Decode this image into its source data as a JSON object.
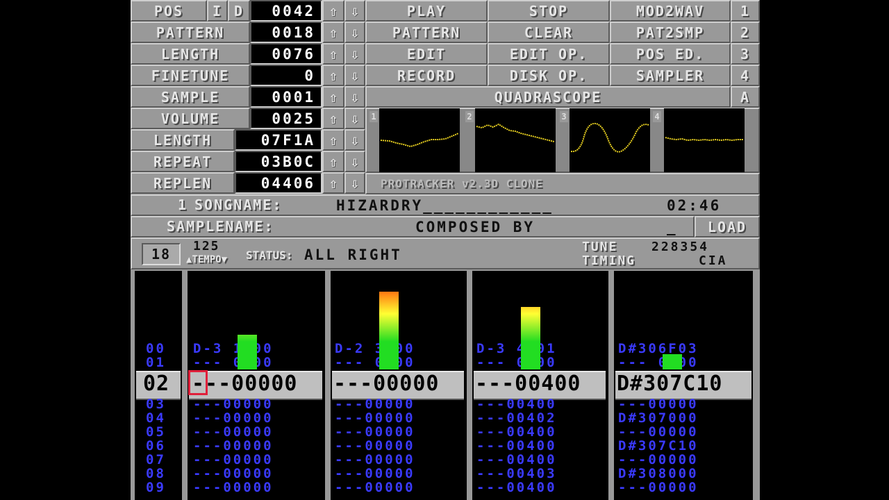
{
  "top_panel": {
    "pos_label": "POS",
    "i_label": "I",
    "d_label": "D",
    "pos_value": "0042",
    "pattern_label": "PATTERN",
    "pattern_value": "0018",
    "length_label": "LENGTH",
    "length_value": "0076",
    "finetune_label": "FINETUNE",
    "finetune_value": "0",
    "sample_label": "SAMPLE",
    "sample_value": "0001",
    "volume_label": "VOLUME",
    "volume_value": "0025",
    "slength_label": "LENGTH",
    "slength_value": "07F1A",
    "repeat_label": "REPEAT",
    "repeat_value": "03B0C",
    "replen_label": "REPLEN",
    "replen_value": "04406",
    "up_arrow": "⇧",
    "down_arrow": "⇩"
  },
  "menu": {
    "play": "PLAY",
    "stop": "STOP",
    "mod2wav": "MOD2WAV",
    "pattern": "PATTERN",
    "clear": "CLEAR",
    "pat2smp": "PAT2SMP",
    "edit": "EDIT",
    "edit_op": "EDIT OP.",
    "pos_ed": "POS ED.",
    "record": "RECORD",
    "disk_op": "DISK OP.",
    "sampler": "SAMPLER",
    "num1": "1",
    "num2": "2",
    "num3": "3",
    "num4": "4",
    "quadrascope": "QUADRASCOPE",
    "quadrascope_key": "A"
  },
  "scopes": {
    "labels": [
      "1",
      "2",
      "3",
      "4"
    ],
    "caption": "PROTRACKER v2.3D CLONE",
    "color": "#e8d020"
  },
  "song": {
    "index": "1",
    "label": "SONGNAME:",
    "name": "HIZARDRY____________",
    "time": "02:46"
  },
  "sample_row": {
    "label": "SAMPLENAME:",
    "name": "COMPOSED BY",
    "underscore": "_",
    "load": "LOAD"
  },
  "status": {
    "pattern_box": "18",
    "tempo_value": "125",
    "tempo_label": "▲TEMPO▼",
    "status_label": "STATUS:",
    "status_text": "ALL RIGHT",
    "tune_label": "TUNE",
    "tune_value": "228354",
    "timing_label": "TIMING",
    "timing_value": "CIA"
  },
  "tracker": {
    "row_numbers_above": [
      "00",
      "01"
    ],
    "current_row": "02",
    "row_numbers_below": [
      "03",
      "04",
      "05",
      "06",
      "07",
      "08",
      "09"
    ],
    "channels": [
      {
        "above": [
          "D-3 1000",
          "--- 0000"
        ],
        "current": "---00000",
        "below": [
          "---00000",
          "---00000",
          "---00000",
          "---00000",
          "---00000",
          "---00000",
          "---00000"
        ]
      },
      {
        "above": [
          "D-2 3000",
          "--- 0000"
        ],
        "current": "---00000",
        "below": [
          "---00000",
          "---00000",
          "---00000",
          "---00000",
          "---00000",
          "---00000",
          "---00000"
        ]
      },
      {
        "above": [
          "D-3 4401",
          "--- 0400"
        ],
        "current": "---00400",
        "below": [
          "---00400",
          "---00402",
          "---00400",
          "---00400",
          "---00400",
          "---00403",
          "---00400"
        ]
      },
      {
        "above": [
          "D#306F03",
          "--- 0000"
        ],
        "current": "D#307C10",
        "below": [
          "---00000",
          "D#307000",
          "---00000",
          "D#307C10",
          "---00000",
          "D#308000",
          "---00000"
        ]
      }
    ],
    "vu_levels": [
      0.45,
      1.0,
      0.8,
      0.2
    ],
    "row_color": "#3a3aff",
    "cursor_color": "#e0203a"
  }
}
